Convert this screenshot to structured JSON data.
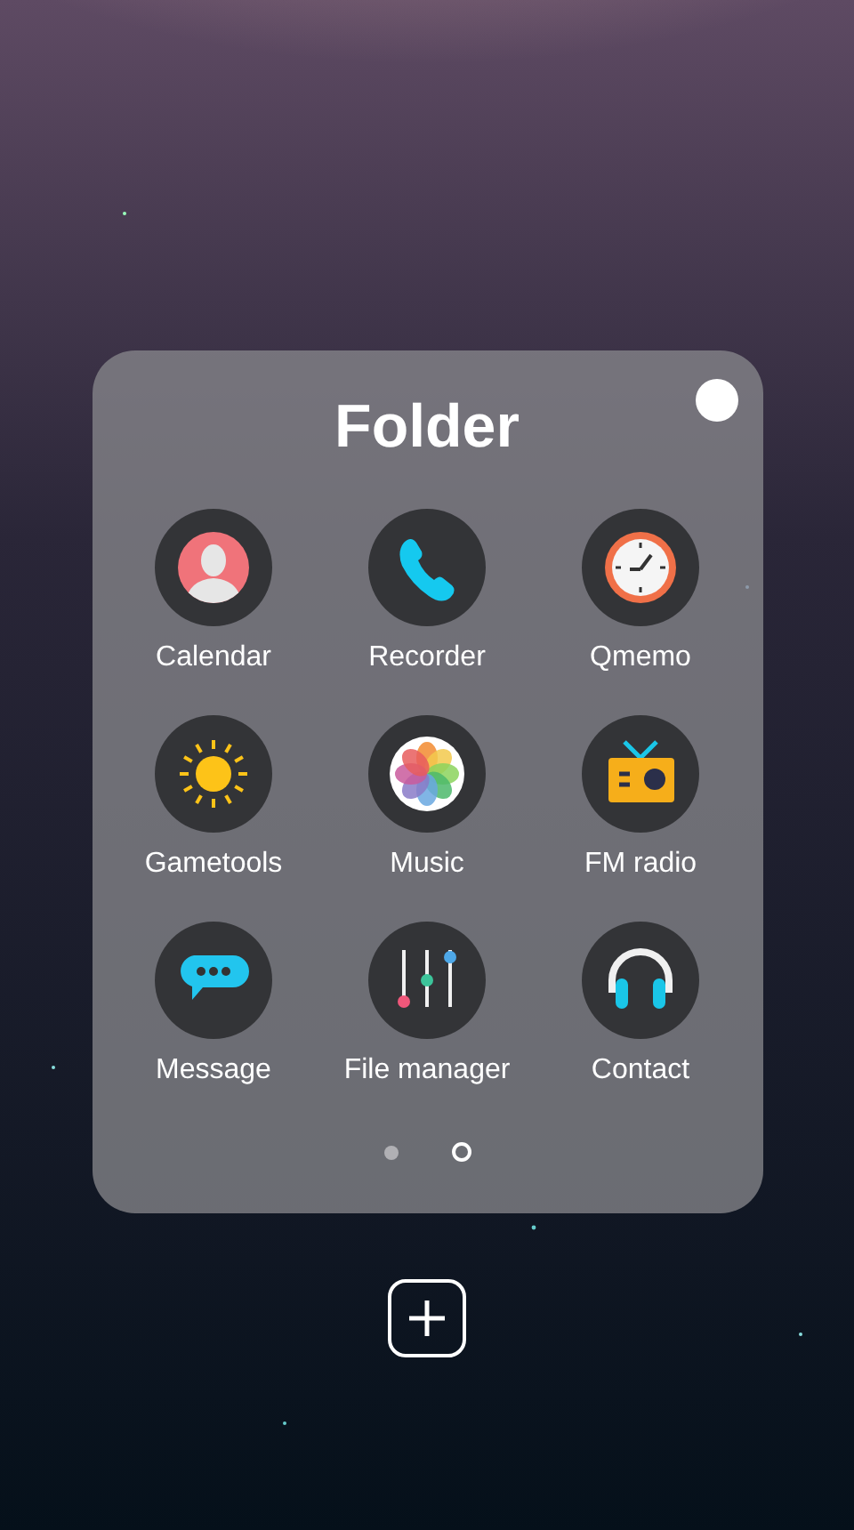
{
  "folder": {
    "title": "Folder"
  },
  "apps": [
    {
      "label": "Calendar",
      "kind": "person"
    },
    {
      "label": "Recorder",
      "kind": "phone"
    },
    {
      "label": "Qmemo",
      "kind": "clock"
    },
    {
      "label": "Gametools",
      "kind": "sun"
    },
    {
      "label": "Music",
      "kind": "flower"
    },
    {
      "label": "FM radio",
      "kind": "radio"
    },
    {
      "label": "Message",
      "kind": "chat"
    },
    {
      "label": "File manager",
      "kind": "sliders"
    },
    {
      "label": "Contact",
      "kind": "headphones"
    }
  ],
  "pages": [
    {
      "selected": false
    },
    {
      "selected": true
    }
  ]
}
